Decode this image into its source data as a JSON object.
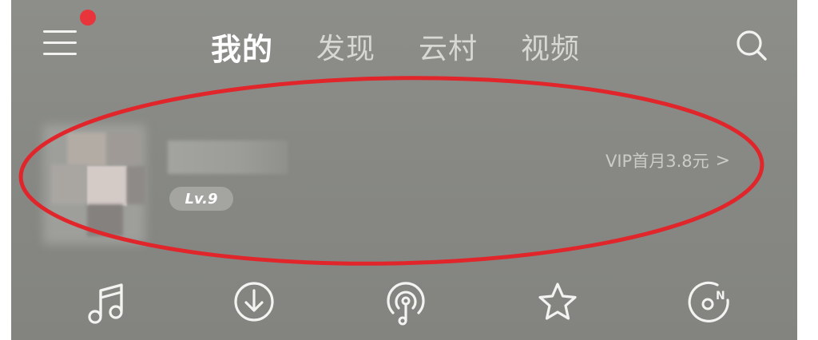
{
  "header": {
    "tabs": [
      {
        "label": "我的",
        "active": true
      },
      {
        "label": "发现",
        "active": false
      },
      {
        "label": "云村",
        "active": false
      },
      {
        "label": "视频",
        "active": false
      }
    ],
    "menu_icon": "hamburger-menu-icon",
    "notification_dot_color": "#e8353b",
    "search_icon": "search-icon"
  },
  "profile": {
    "level": "Lv.9",
    "vip_promo": "VIP首月3.8元",
    "vip_chevron": ">",
    "highlight_color": "#e0252b"
  },
  "quick_actions": [
    {
      "icon": "music-note-icon"
    },
    {
      "icon": "download-icon"
    },
    {
      "icon": "radio-podcast-icon"
    },
    {
      "icon": "star-icon"
    },
    {
      "icon": "new-song-disc-icon"
    }
  ]
}
